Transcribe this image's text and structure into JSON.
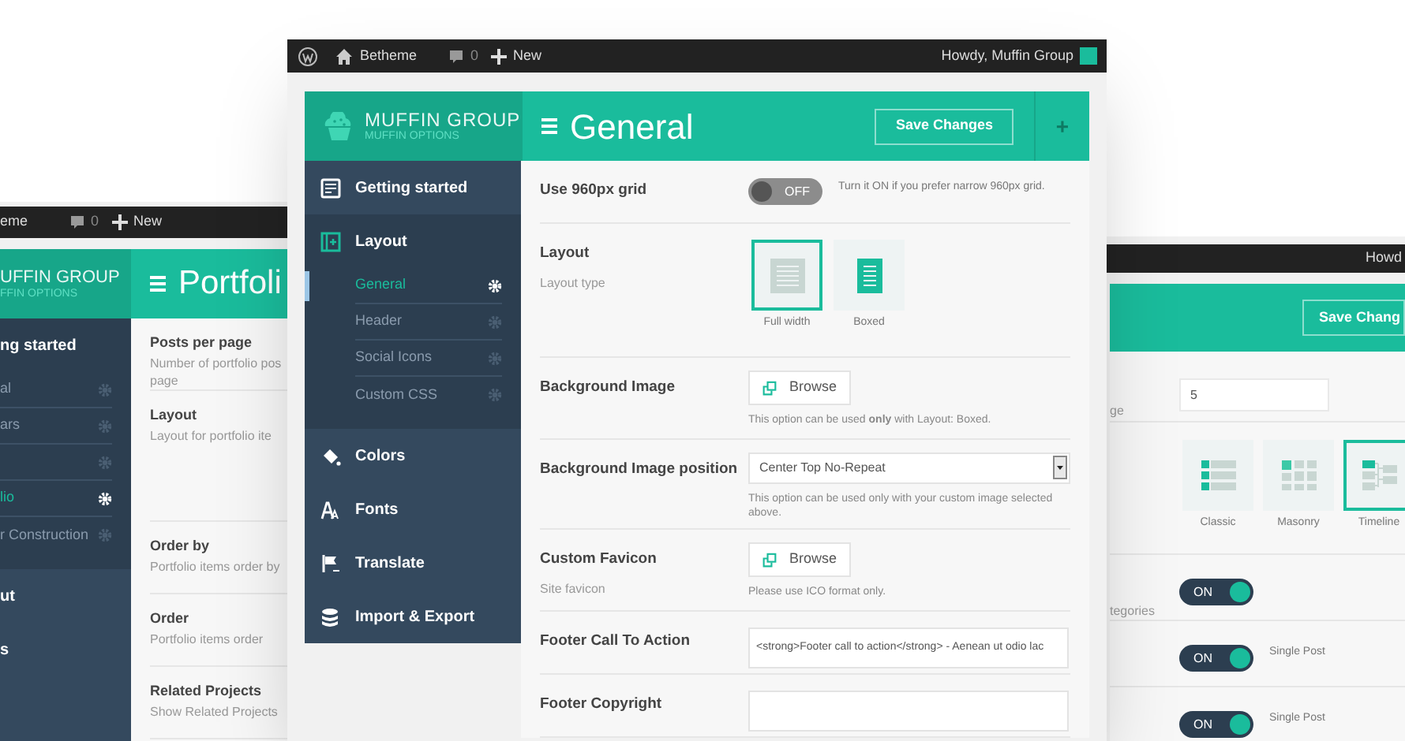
{
  "left_window": {
    "admin_bar": {
      "site": "eme",
      "comments": "0",
      "new": "New"
    },
    "brand": {
      "name": "UFFIN GROUP",
      "subtitle": "FFIN OPTIONS"
    },
    "title": "Portfoli",
    "sidebar": [
      {
        "label": "ng started",
        "expanded": true,
        "children": [
          {
            "label": "al",
            "selected": false
          },
          {
            "label": "ars",
            "selected": false
          },
          {
            "selected": false
          },
          {
            "label": "lio",
            "selected": true
          },
          {
            "label": "r Construction",
            "selected": false
          }
        ]
      },
      {
        "label": "ut",
        "expanded": false
      },
      {
        "label": "s",
        "expanded": false
      }
    ],
    "settings": [
      {
        "label": "Posts per page",
        "description": [
          "Number of portfolio pos",
          "page"
        ]
      },
      {
        "label": "Layout",
        "description": [
          "Layout for portfolio ite"
        ]
      },
      {
        "label": "Order by",
        "description": [
          "Portfolio items order by"
        ]
      },
      {
        "label": "Order",
        "description": [
          "Portfolio items order"
        ]
      },
      {
        "label": "Related Projects",
        "description": [
          "Show Related Projects"
        ]
      }
    ]
  },
  "main_window": {
    "admin_bar": {
      "site": "Betheme",
      "comments": "0",
      "new": "New",
      "greeting": "Howdy, Muffin Group"
    },
    "brand": {
      "name": "MUFFIN GROUP",
      "subtitle": "MUFFIN OPTIONS"
    },
    "title": "General",
    "save_button": "Save Changes",
    "add_button": "+",
    "sidebar": [
      {
        "label": "Getting started",
        "expanded": false
      },
      {
        "label": "Layout",
        "expanded": true,
        "children": [
          {
            "label": "General",
            "selected": true
          },
          {
            "label": "Header",
            "selected": false
          },
          {
            "label": "Social Icons",
            "selected": false
          },
          {
            "label": "Custom CSS",
            "selected": false
          }
        ]
      },
      {
        "label": "Colors",
        "expanded": false
      },
      {
        "label": "Fonts",
        "expanded": false
      },
      {
        "label": "Translate",
        "expanded": false
      },
      {
        "label": "Import & Export",
        "expanded": false
      }
    ],
    "settings": [
      {
        "kind": "toggle",
        "label": "Use 960px grid",
        "on": false,
        "toggle_text": "OFF",
        "note": "Turn it ON if you prefer narrow 960px grid."
      },
      {
        "kind": "layout_picker",
        "label": "Layout",
        "description": "Layout type",
        "options": [
          {
            "label": "Full width",
            "selected": true
          },
          {
            "label": "Boxed",
            "selected": false
          }
        ]
      },
      {
        "kind": "upload",
        "label": "Background Image",
        "button": "Browse",
        "note": "This option can be used **only** with Layout: Boxed."
      },
      {
        "kind": "select",
        "label": "Background Image position",
        "value": "Center Top No-Repeat",
        "note": "This option can be used only with your custom image selected above."
      },
      {
        "kind": "upload",
        "label": "Custom Favicon",
        "description": "Site favicon",
        "button": "Browse",
        "note": "Please use ICO format only."
      },
      {
        "kind": "text_input",
        "label": "Footer Call To Action",
        "value": "<strong>Footer call to action</strong> - Aenean ut odio lac"
      },
      {
        "kind": "text_input",
        "label": "Footer Copyright"
      }
    ]
  },
  "right_window": {
    "admin_bar": {
      "greeting": "Howd"
    },
    "save_button": "Save Chang",
    "settings": [
      {
        "kind": "text_input",
        "label": "ge",
        "value": "5"
      },
      {
        "kind": "layout_picker",
        "options": [
          {
            "label": "Classic",
            "selected": false
          },
          {
            "label": "Masonry",
            "selected": false
          },
          {
            "label": "Timeline",
            "selected": true
          }
        ]
      },
      {
        "kind": "toggle",
        "label": "tegories",
        "on": true,
        "toggle_text": "ON"
      },
      {
        "kind": "toggle",
        "on": true,
        "toggle_text": "ON",
        "note": "Single Post"
      },
      {
        "kind": "toggle",
        "on": true,
        "toggle_text": "ON",
        "note": "Single Post"
      }
    ]
  }
}
